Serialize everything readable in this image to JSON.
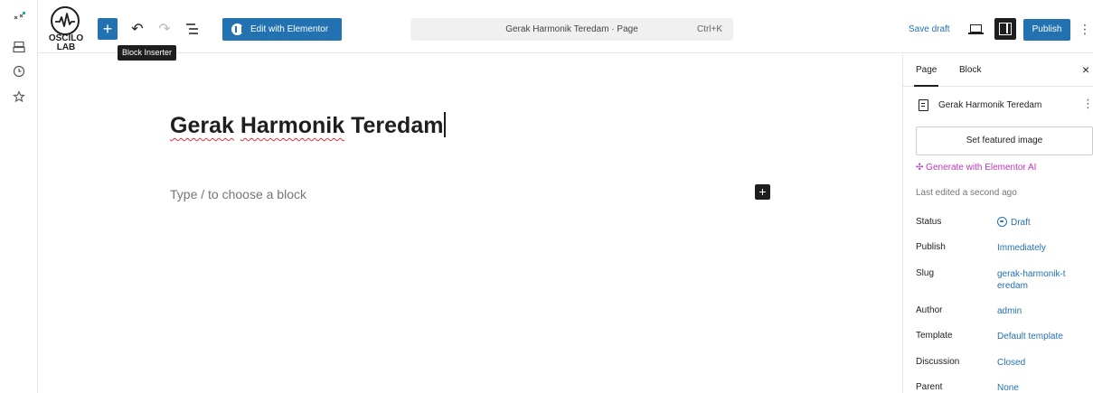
{
  "logo": {
    "line1": "OSCILO",
    "line2": "LAB"
  },
  "toolbar": {
    "add_block": "+",
    "undo": "↶",
    "redo": "↷",
    "outline": "☰",
    "tooltip": "Block Inserter",
    "elementor_label": "Edit with Elementor",
    "command_title": "Gerak Harmonik Teredam · Page",
    "command_shortcut": "Ctrl+K",
    "save_draft": "Save draft",
    "publish": "Publish",
    "more": "⋮"
  },
  "editor": {
    "title_word1": "Gerak",
    "title_word2": "Harmonik",
    "title_word3": "Teredam",
    "placeholder": "Type / to choose a block",
    "inline_add": "+"
  },
  "sidebar": {
    "tabs": [
      "Page",
      "Block"
    ],
    "active_tab": "Page",
    "close": "×",
    "doc_title": "Gerak Harmonik Teredam",
    "doc_more": "⋮",
    "featured_image": "Set featured image",
    "generate_ai": "Generate with Elementor AI",
    "last_edited": "Last edited a second ago",
    "props": [
      {
        "label": "Status",
        "value": "Draft"
      },
      {
        "label": "Publish",
        "value": "Immediately"
      },
      {
        "label": "Slug",
        "value": "gerak-harmonik-teredam"
      },
      {
        "label": "Author",
        "value": "admin"
      },
      {
        "label": "Template",
        "value": "Default template"
      },
      {
        "label": "Discussion",
        "value": "Closed"
      },
      {
        "label": "Parent",
        "value": "None"
      }
    ]
  },
  "colors": {
    "accent": "#2271b1",
    "dark": "#1e1e1e",
    "ai": "#c036c0",
    "spellcheck": "#d63638"
  }
}
